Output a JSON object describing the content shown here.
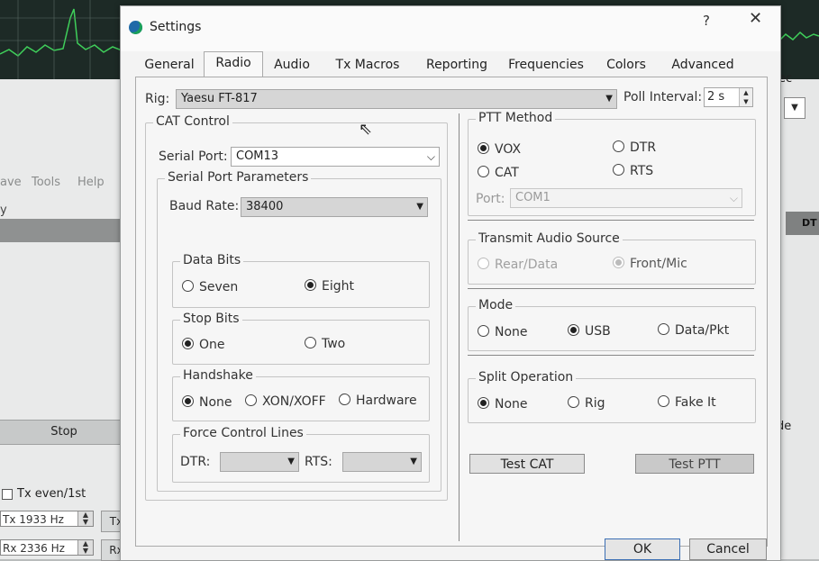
{
  "background_app": {
    "menu": [
      "ave",
      "Tools",
      "Help"
    ],
    "partial_y": "y",
    "stop_label": "Stop",
    "tx_even_label": "Tx even/1st",
    "tx_spin": "Tx  1933  Hz",
    "rx_spin": "Rx  2336  Hz",
    "tx_btn": "Tx",
    "rx_btn": "Rx",
    "right_sec": "ec",
    "right_dt": "DT",
    "right_de": "de"
  },
  "dialog": {
    "title": "Settings",
    "help": "?",
    "close": "✕",
    "tabs": [
      "General",
      "Radio",
      "Audio",
      "Tx Macros",
      "Reporting",
      "Frequencies",
      "Colors",
      "Advanced"
    ],
    "active_tab": "Radio",
    "rig_label": "Rig:",
    "rig_value": "Yaesu FT-817",
    "poll_label": "Poll Interval:",
    "poll_value": "2 s",
    "cat": {
      "title": "CAT Control",
      "serial_port_label": "Serial Port:",
      "serial_port_value": "COM13",
      "params_title": "Serial Port Parameters",
      "baud_label": "Baud Rate:",
      "baud_value": "38400",
      "data_bits": {
        "title": "Data Bits",
        "options": [
          "Seven",
          "Eight"
        ],
        "selected": "Eight"
      },
      "stop_bits": {
        "title": "Stop Bits",
        "options": [
          "One",
          "Two"
        ],
        "selected": "One"
      },
      "handshake": {
        "title": "Handshake",
        "options": [
          "None",
          "XON/XOFF",
          "Hardware"
        ],
        "selected": "None"
      },
      "force": {
        "title": "Force Control Lines",
        "dtr_label": "DTR:",
        "rts_label": "RTS:"
      }
    },
    "ptt": {
      "title": "PTT Method",
      "options": [
        "VOX",
        "DTR",
        "CAT",
        "RTS"
      ],
      "selected": "VOX",
      "port_label": "Port:",
      "port_value": "COM1"
    },
    "audio_source": {
      "title": "Transmit Audio Source",
      "options": [
        "Rear/Data",
        "Front/Mic"
      ],
      "selected": "Front/Mic"
    },
    "mode": {
      "title": "Mode",
      "options": [
        "None",
        "USB",
        "Data/Pkt"
      ],
      "selected": "USB"
    },
    "split": {
      "title": "Split Operation",
      "options": [
        "None",
        "Rig",
        "Fake It"
      ],
      "selected": "None"
    },
    "test_cat": "Test CAT",
    "test_ptt": "Test PTT",
    "ok": "OK",
    "cancel": "Cancel"
  }
}
